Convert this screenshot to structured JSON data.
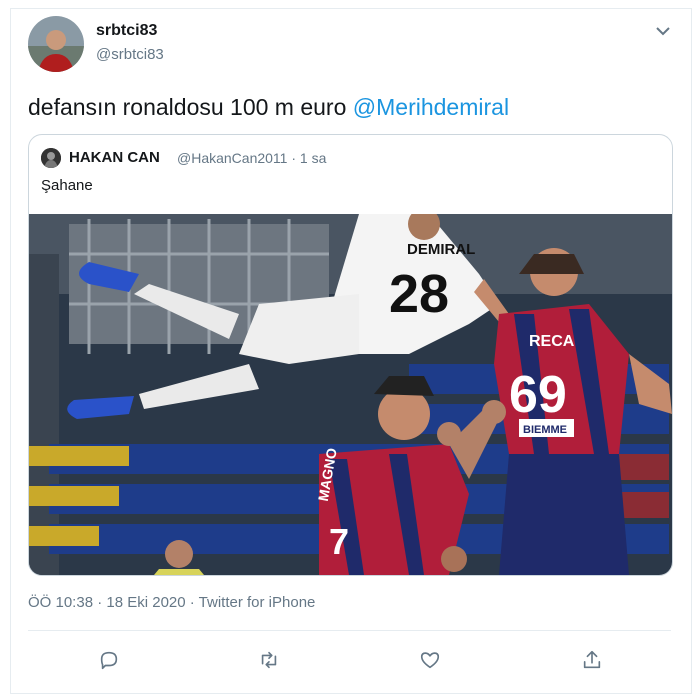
{
  "tweet": {
    "author_name": "srbtci83",
    "author_handle": "@srbtci83",
    "text": "defansın ronaldosu 100 m euro ",
    "mention": "@Merihdemiral",
    "timestamp": "ÖÖ 10:38 · 18 Eki 2020 · Twitter for iPhone"
  },
  "quoted_tweet": {
    "author_name": "HAKAN CAN",
    "author_meta": "@HakanCan2011 · 1 sa",
    "text": "Şahane",
    "photo": {
      "jersey_top": "DEMIRAL",
      "jersey_top_number": "28",
      "jersey_right": "RECA",
      "jersey_right_number": "69",
      "sponsor": "BIEMME",
      "jersey_bottom": "MAGNO",
      "jersey_bottom_number": "7"
    }
  },
  "actions": [
    {
      "name": "reply",
      "icon": "reply-icon"
    },
    {
      "name": "retweet",
      "icon": "retweet-icon"
    },
    {
      "name": "like",
      "icon": "heart-icon"
    },
    {
      "name": "share",
      "icon": "share-icon"
    }
  ],
  "colors": {
    "text": "#14171a",
    "secondary": "#657786",
    "link": "#1b95e0",
    "border": "#ccd6dd"
  }
}
